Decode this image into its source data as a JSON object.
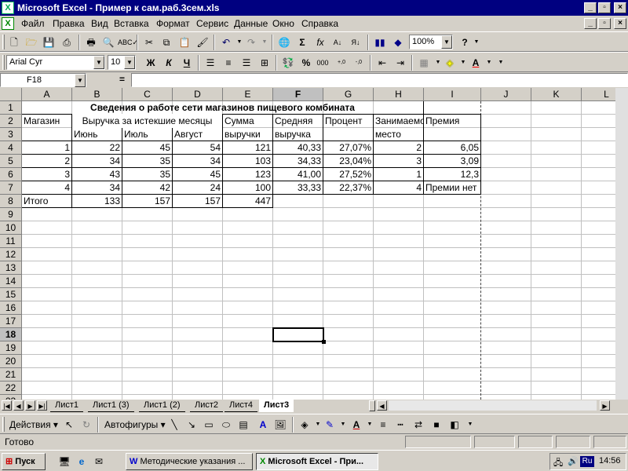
{
  "titlebar": {
    "title": "Microsoft Excel - Пример к сам.раб.3сем.xls",
    "app_icon": "X",
    "minimize": "_",
    "restore": "▫",
    "close": "×"
  },
  "menubar": {
    "items": [
      "Файл",
      "Правка",
      "Вид",
      "Вставка",
      "Формат",
      "Сервис",
      "Данные",
      "Окно",
      "Справка"
    ]
  },
  "standard_toolbar": {
    "zoom": "100%",
    "icons": [
      "new-icon",
      "open-icon",
      "save-icon",
      "print-icon",
      "print-preview-icon",
      "spelling-icon",
      "cut-icon",
      "copy-icon",
      "paste-icon",
      "format-painter-icon",
      "undo-icon",
      "redo-icon",
      "hyperlink-icon",
      "autosum-icon",
      "function-icon",
      "sort-ascending-icon",
      "sort-descending-icon",
      "chart-wizard-icon",
      "drawing-icon",
      "help-icon"
    ]
  },
  "formatting_toolbar": {
    "font": "Arial Cyr",
    "size": "10",
    "bold": "Ж",
    "italic": "К",
    "underline": "Ч",
    "percent": "%",
    "thousands": "000",
    "inc_decimal": ",00→,0",
    "dec_decimal": ",0→,00"
  },
  "formula_bar": {
    "name_box": "F18",
    "equals": "=",
    "formula": ""
  },
  "grid": {
    "columns": [
      "A",
      "B",
      "C",
      "D",
      "E",
      "F",
      "G",
      "H",
      "I",
      "J",
      "K",
      "L"
    ],
    "rows": [
      "1",
      "2",
      "3",
      "4",
      "5",
      "6",
      "7",
      "8",
      "9",
      "10",
      "11",
      "12",
      "13",
      "14",
      "15",
      "16",
      "17",
      "18",
      "19",
      "20",
      "21",
      "22",
      "23"
    ],
    "selected_col": "F",
    "selected_row": "18",
    "title": "Сведения о работе сети магазинов пищевого комбината",
    "header2": {
      "a": "Магазин",
      "bcd": "Выручка за истекшие месяцы",
      "e": "Сумма",
      "f": "Средняя",
      "g": "Процент",
      "h": "Занимаемо",
      "i": "Премия"
    },
    "header3": {
      "b": "Июнь",
      "c": "Июль",
      "d": "Август",
      "e": "выручки",
      "f": "выручка",
      "h": "место"
    },
    "data": [
      [
        "1",
        "22",
        "45",
        "54",
        "121",
        "40,33",
        "27,07%",
        "2",
        "6,05"
      ],
      [
        "2",
        "34",
        "35",
        "34",
        "103",
        "34,33",
        "23,04%",
        "3",
        "3,09"
      ],
      [
        "3",
        "43",
        "35",
        "45",
        "123",
        "41,00",
        "27,52%",
        "1",
        "12,3"
      ],
      [
        "4",
        "34",
        "42",
        "24",
        "100",
        "33,33",
        "22,37%",
        "4",
        "Премии нет"
      ]
    ],
    "total": [
      "Итого",
      "133",
      "157",
      "157",
      "447"
    ]
  },
  "sheet_tabs": [
    "Лист1",
    "Лист1 (3)",
    "Лист1 (2)",
    "Лист2",
    "Лист4",
    "Лист3"
  ],
  "active_tab": "Лист3",
  "drawing_toolbar": {
    "actions": "Действия",
    "autoshapes": "Автофигуры"
  },
  "status": {
    "text": "Готово"
  },
  "taskbar": {
    "start": "Пуск",
    "tasks": [
      "Методические указания ...",
      "Microsoft Excel - При..."
    ],
    "lang": "Ru",
    "clock": "14:56"
  }
}
